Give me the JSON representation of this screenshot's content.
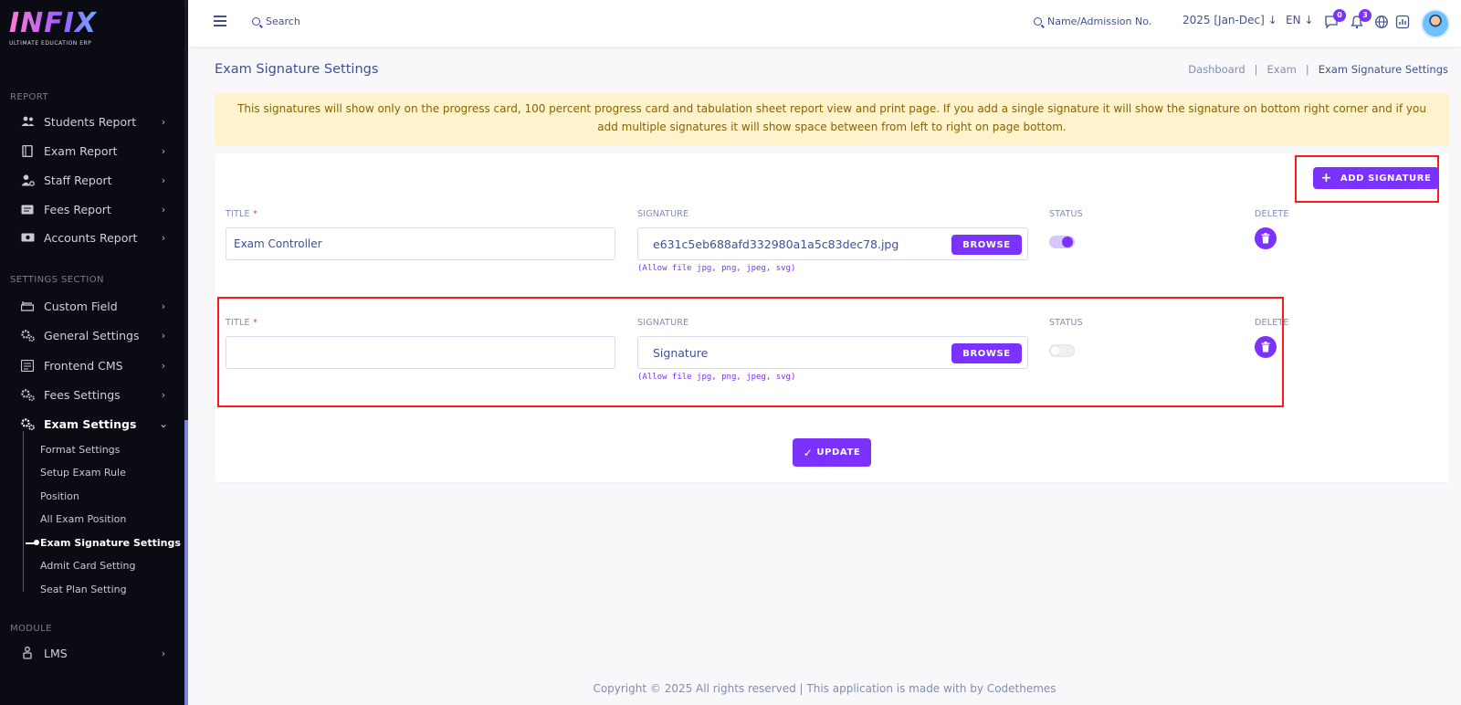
{
  "app": {
    "logo_text": "INFIX",
    "logo_tagline": "ULTIMATE EDUCATION ERP"
  },
  "colors": {
    "accent": "#7c32ff",
    "sidebar_bg": "#0b0b14",
    "alert_bg": "#fff3cd",
    "highlight": "#ff1a1a"
  },
  "sidebar": {
    "report_title": "REPORT",
    "report_items": [
      {
        "label": "Students Report",
        "icon": "users-icon"
      },
      {
        "label": "Exam Report",
        "icon": "book-icon"
      },
      {
        "label": "Staff Report",
        "icon": "user-gear-icon"
      },
      {
        "label": "Fees Report",
        "icon": "receipt-icon"
      },
      {
        "label": "Accounts Report",
        "icon": "money-icon"
      }
    ],
    "settings_title": "SETTINGS SECTION",
    "settings_items": [
      {
        "label": "Custom Field",
        "icon": "layers-icon"
      },
      {
        "label": "General Settings",
        "icon": "cogs-icon"
      },
      {
        "label": "Frontend CMS",
        "icon": "cms-icon"
      },
      {
        "label": "Fees Settings",
        "icon": "cogs-icon"
      },
      {
        "label": "Exam Settings",
        "icon": "cogs-icon"
      }
    ],
    "exam_sub_items": [
      "Format Settings",
      "Setup Exam Rule",
      "Position",
      "All Exam Position",
      "Exam Signature Settings",
      "Admit Card Setting",
      "Seat Plan Setting"
    ],
    "module_title": "MODULE",
    "module_items": [
      {
        "label": "LMS",
        "icon": "lms-icon"
      }
    ]
  },
  "topbar": {
    "search_label": "Search",
    "admission_search_label": "Name/Admission No.",
    "session": "2025 [Jan-Dec]",
    "language": "EN",
    "message_count": "0",
    "notification_count": "3"
  },
  "page": {
    "title": "Exam Signature Settings",
    "breadcrumb": [
      "Dashboard",
      "Exam",
      "Exam Signature Settings"
    ],
    "alert": "This signatures will show only on the progress card, 100 percent progress card and tabulation sheet report view and print page. If you add a single signature it will show the signature on bottom right corner and if you add multiple signatures it will show space between from left to right on page bottom.",
    "add_button": "ADD SIGNATURE",
    "labels": {
      "title": "TITLE",
      "required": "*",
      "signature": "SIGNATURE",
      "status": "STATUS",
      "delete": "DELETE",
      "browse": "BROWSE",
      "hint": "(Allow file jpg, png, jpeg, svg)"
    },
    "rows": [
      {
        "title": "Exam Controller",
        "signature": "e631c5eb688afd332980a1a5c83dec78.jpg",
        "status": true
      },
      {
        "title": "",
        "signature": "Signature",
        "status": false
      }
    ],
    "update_button": "UPDATE"
  },
  "footer": {
    "text": "Copyright © 2025 All rights reserved | This application is made with by Codethemes"
  }
}
